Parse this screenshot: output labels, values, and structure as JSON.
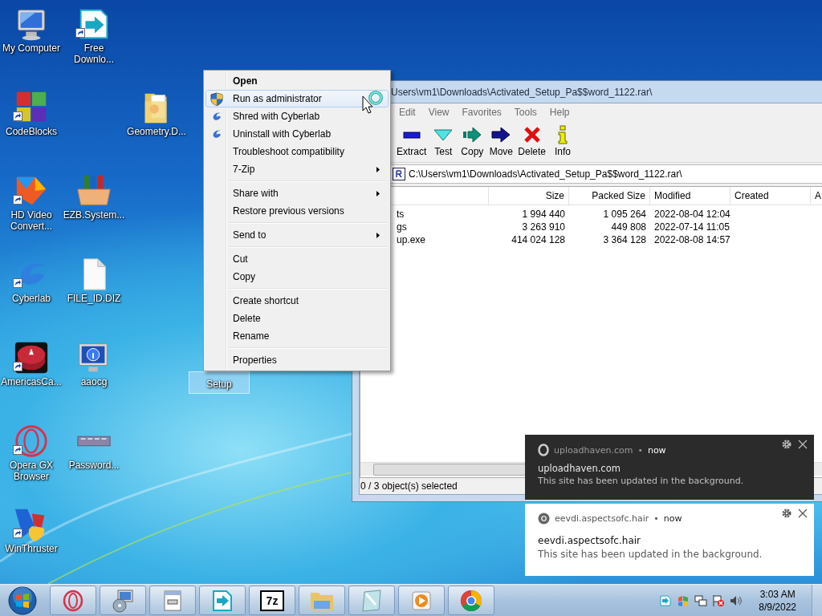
{
  "desktop": {
    "icons": [
      {
        "label": "My Computer",
        "shortcut": false,
        "selected": false
      },
      {
        "label": "Free Downlo...",
        "shortcut": true,
        "selected": false
      },
      {
        "label": "CodeBlocks",
        "shortcut": true,
        "selected": false
      },
      {
        "label": "Geometry.D...",
        "shortcut": false,
        "selected": false
      },
      {
        "label": "HD Video Convert...",
        "shortcut": true,
        "selected": false
      },
      {
        "label": "EZB.System...",
        "shortcut": false,
        "selected": false
      },
      {
        "label": "Cyberlab",
        "shortcut": true,
        "selected": false
      },
      {
        "label": "FILE_ID.DIZ",
        "shortcut": false,
        "selected": false
      },
      {
        "label": "AmericasCa...",
        "shortcut": true,
        "selected": false
      },
      {
        "label": "aaocg",
        "shortcut": false,
        "selected": false
      },
      {
        "label": "Setup",
        "shortcut": false,
        "selected": true
      },
      {
        "label": "Opera GX Browser",
        "shortcut": true,
        "selected": false
      },
      {
        "label": "Password...",
        "shortcut": false,
        "selected": false
      },
      {
        "label": "WinThruster",
        "shortcut": true,
        "selected": false
      }
    ]
  },
  "archive_window": {
    "title": "Users\\vm1\\Downloads\\Activated_Setup_Pa$$word_1122.rar\\",
    "menu": [
      "Edit",
      "View",
      "Favorites",
      "Tools",
      "Help"
    ],
    "toolbar": [
      {
        "label": "Extract",
        "kind": "extract"
      },
      {
        "label": "Test",
        "kind": "test"
      },
      {
        "label": "Copy",
        "kind": "copy"
      },
      {
        "label": "Move",
        "kind": "move"
      },
      {
        "label": "Delete",
        "kind": "delete"
      },
      {
        "label": "Info",
        "kind": "info"
      }
    ],
    "address": "C:\\Users\\vm1\\Downloads\\Activated_Setup_Pa$$word_1122.rar\\",
    "table": {
      "columns": [
        "Size",
        "Packed Size",
        "Modified",
        "Created",
        "A"
      ],
      "rows": [
        {
          "column_1": "ts",
          "size": "1 994 440",
          "packed_size": "1 095 264",
          "modified": "2022-08-04 12:04"
        },
        {
          "column_1": "gs",
          "size": "3 263 910",
          "packed_size": "449 808",
          "modified": "2022-07-14 11:05"
        },
        {
          "column_1": "up.exe",
          "size": "414 024 128",
          "packed_size": "3 364 128",
          "modified": "2022-08-08 14:57"
        }
      ]
    },
    "status_bar": "0 / 3 object(s) selected"
  },
  "context_menu": {
    "groups": [
      [
        {
          "label": "Open",
          "kind": "plain",
          "default": true,
          "selected": false,
          "submenu": false
        },
        {
          "label": "Run as administrator",
          "kind": "uac",
          "default": false,
          "selected": true,
          "submenu": false
        },
        {
          "label": "Shred with Cyberlab",
          "kind": "app",
          "default": false,
          "selected": false,
          "submenu": false
        },
        {
          "label": "Uninstall with Cyberlab",
          "kind": "app",
          "default": false,
          "selected": false,
          "submenu": false
        },
        {
          "label": "Troubleshoot compatibility",
          "kind": "plain",
          "default": false,
          "selected": false,
          "submenu": false
        },
        {
          "label": "7-Zip",
          "kind": "plain",
          "default": false,
          "selected": false,
          "submenu": true
        }
      ],
      [
        {
          "label": "Share with",
          "kind": "plain",
          "default": false,
          "selected": false,
          "submenu": true
        },
        {
          "label": "Restore previous versions",
          "kind": "plain",
          "default": false,
          "selected": false,
          "submenu": false
        }
      ],
      [
        {
          "label": "Send to",
          "kind": "plain",
          "default": false,
          "selected": false,
          "submenu": true
        }
      ],
      [
        {
          "label": "Cut",
          "kind": "plain",
          "default": false,
          "selected": false,
          "submenu": false
        },
        {
          "label": "Copy",
          "kind": "plain",
          "default": false,
          "selected": false,
          "submenu": false
        }
      ],
      [
        {
          "label": "Create shortcut",
          "kind": "plain",
          "default": false,
          "selected": false,
          "submenu": false
        },
        {
          "label": "Delete",
          "kind": "plain",
          "default": false,
          "selected": false,
          "submenu": false
        },
        {
          "label": "Rename",
          "kind": "plain",
          "default": false,
          "selected": false,
          "submenu": false
        }
      ],
      [
        {
          "label": "Properties",
          "kind": "plain",
          "default": false,
          "selected": false,
          "submenu": false
        }
      ]
    ]
  },
  "notifications": [
    {
      "kind": "dark",
      "site": "uploadhaven.com",
      "dot": "•",
      "time": "now",
      "title": "uploadhaven.com",
      "body": "This site has been updated in the background."
    },
    {
      "kind": "light",
      "site": "eevdi.aspectsofc.hair",
      "dot": "•",
      "time": "now",
      "title": "eevdi.aspectsofc.hair",
      "body": "This site has been updated in the background."
    }
  ],
  "taskbar": {
    "apps": [
      {
        "kind": "opera"
      },
      {
        "kind": "installer"
      },
      {
        "kind": "window"
      },
      {
        "kind": "download"
      },
      {
        "kind": "archiver",
        "label": "7z"
      },
      {
        "kind": "folder"
      },
      {
        "kind": "notepad"
      },
      {
        "kind": "media"
      },
      {
        "kind": "chrome"
      }
    ],
    "clock": {
      "time": "3:03 AM",
      "date": "8/9/2022"
    }
  }
}
